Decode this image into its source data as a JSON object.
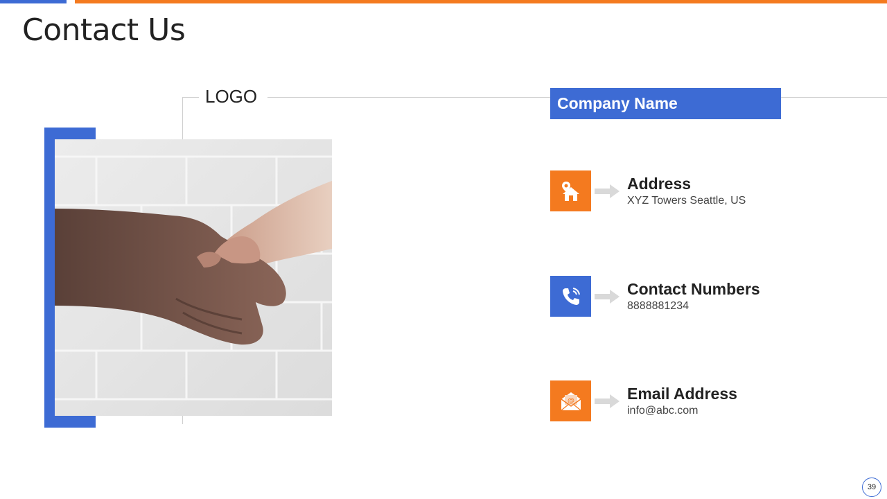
{
  "page": {
    "title": "Contact Us",
    "logo_text": "LOGO",
    "page_number": "39"
  },
  "company": {
    "name": "Company Name"
  },
  "contacts": [
    {
      "label": "Address",
      "value": "XYZ Towers Seattle, US",
      "icon": "home-location-icon",
      "color": "#f47a1f"
    },
    {
      "label": "Contact Numbers",
      "value": "8888881234",
      "icon": "phone-icon",
      "color": "#3d6bd4"
    },
    {
      "label": "Email Address",
      "value": "info@abc.com",
      "icon": "email-icon",
      "color": "#f47a1f"
    }
  ],
  "image": {
    "subject": "handshake-photo"
  },
  "colors": {
    "accent_blue": "#3d6bd4",
    "accent_orange": "#f47a1f"
  }
}
